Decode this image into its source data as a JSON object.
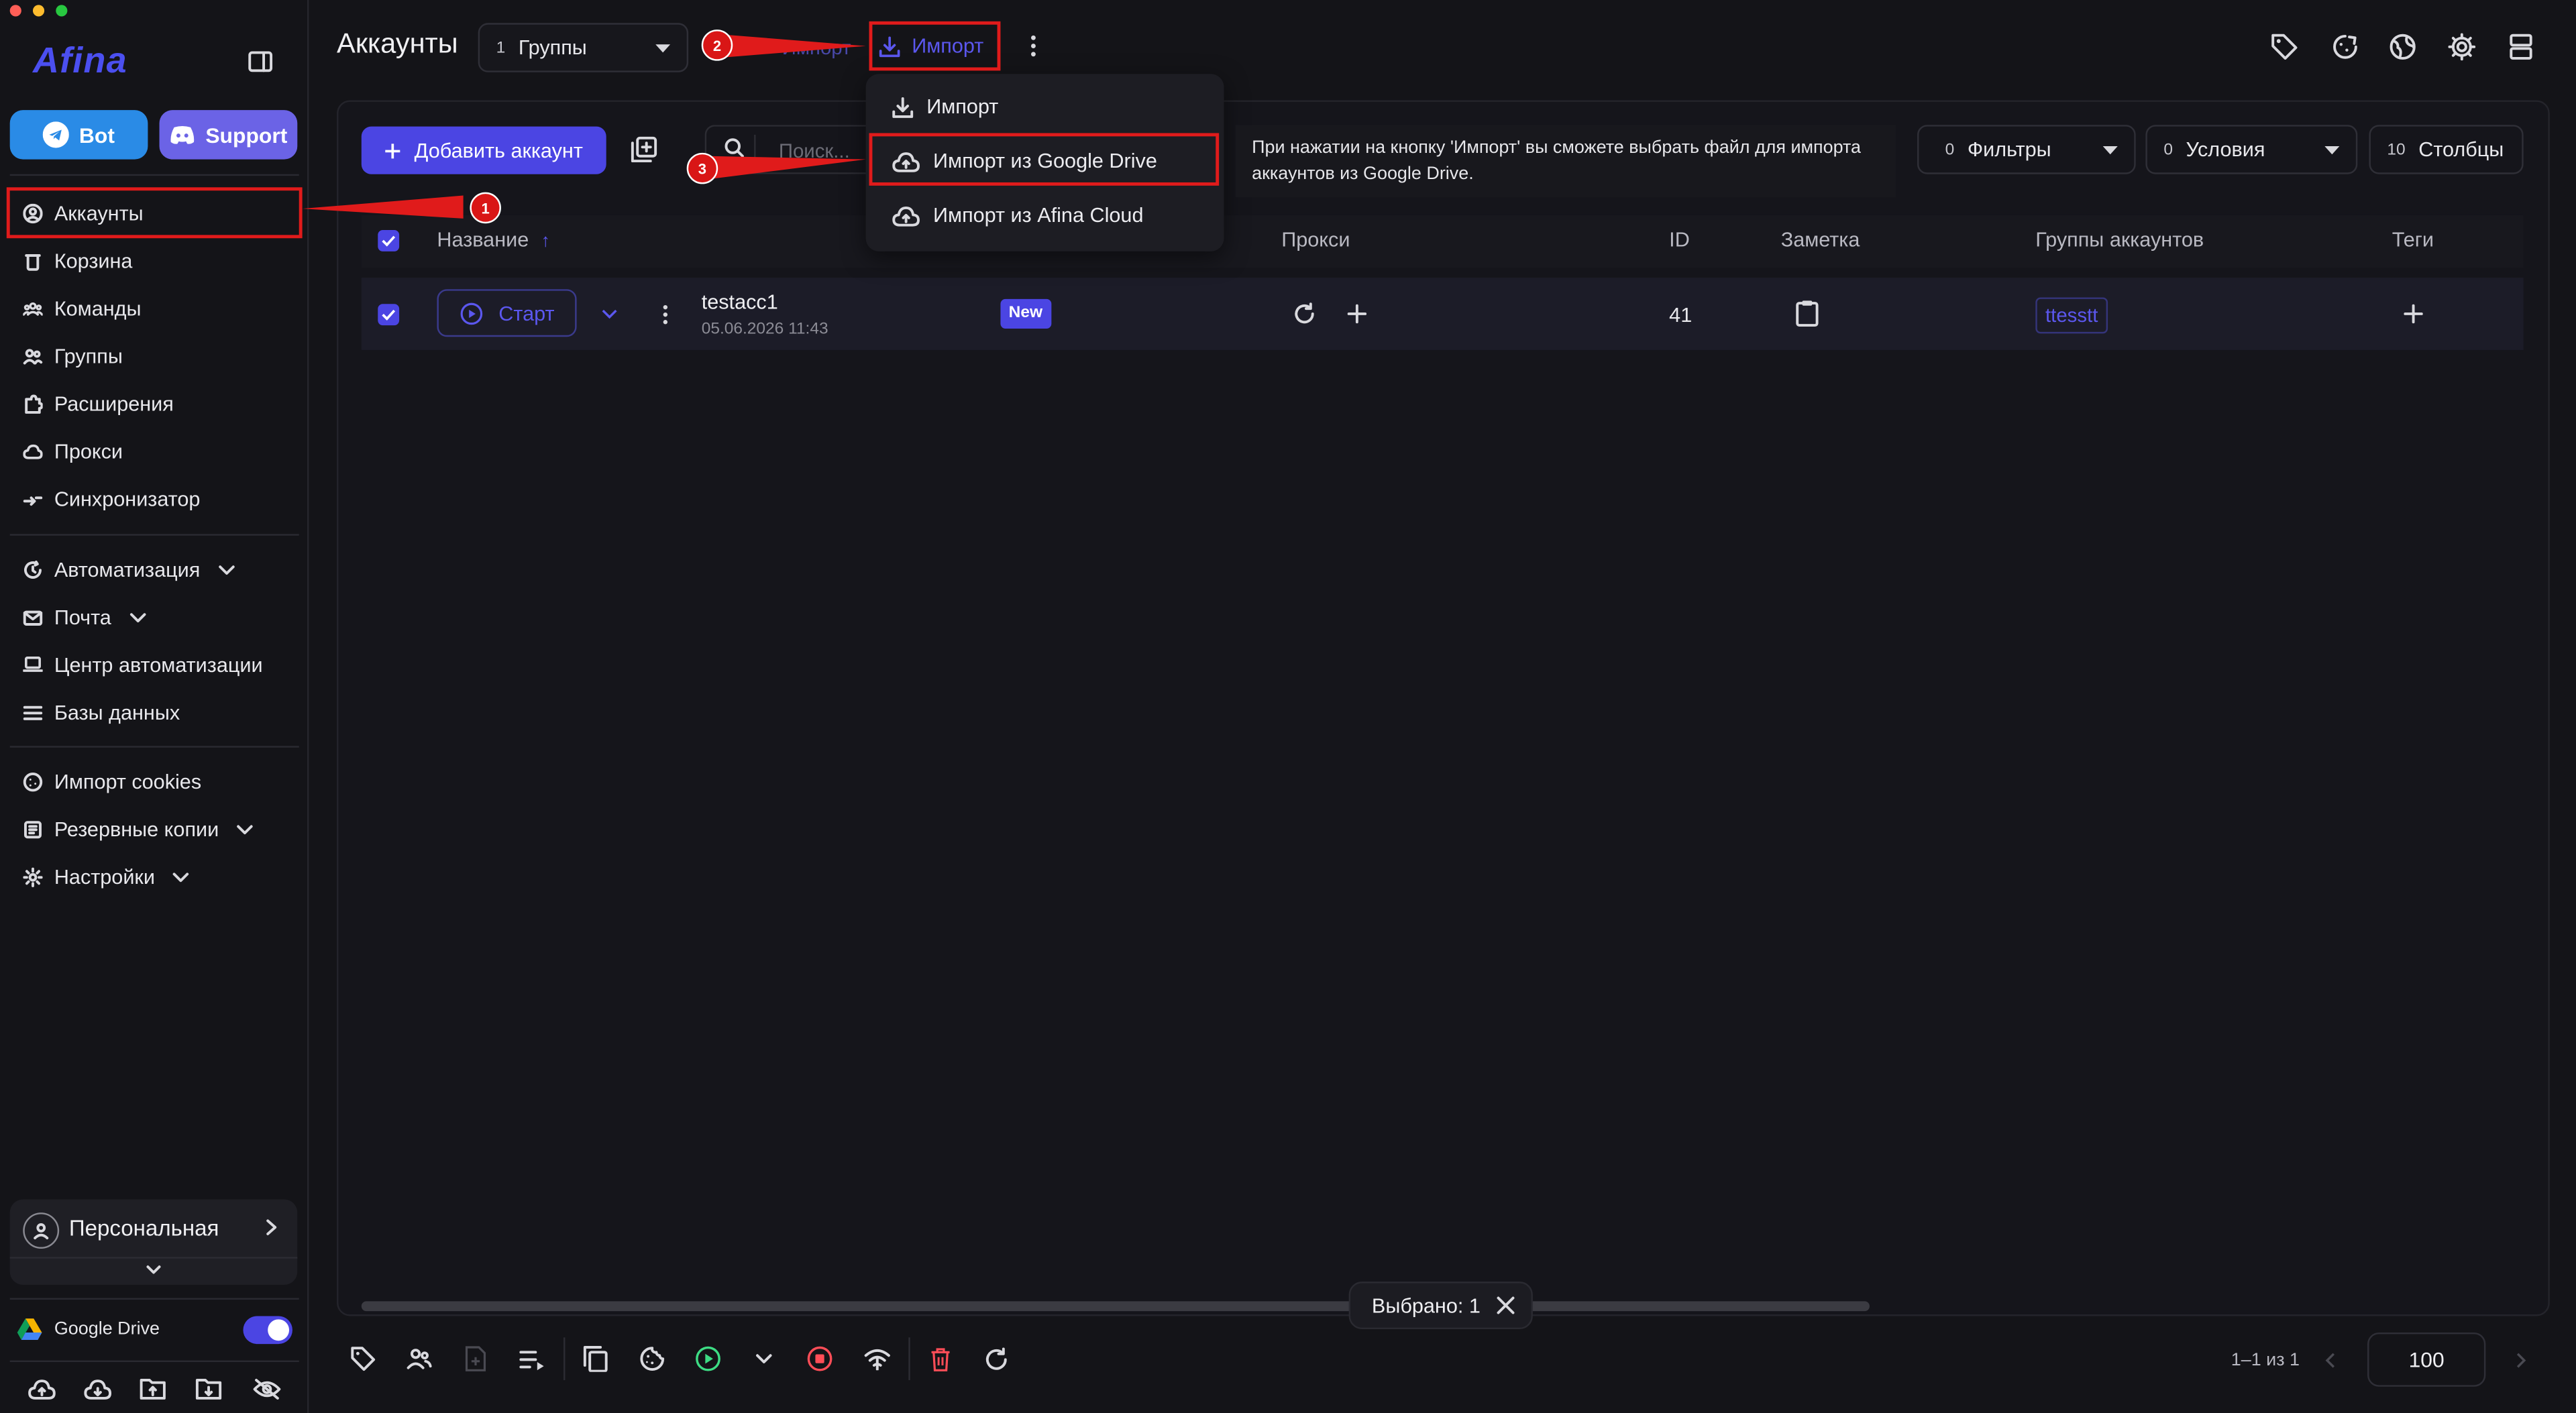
{
  "window": {
    "title": "Аккаунты"
  },
  "sidebar": {
    "logo": "Afina",
    "bot_label": "Bot",
    "support_label": "Support",
    "items_top": [
      {
        "label": "Аккаунты",
        "icon": "user-circle-icon"
      },
      {
        "label": "Корзина",
        "icon": "trash-icon"
      },
      {
        "label": "Команды",
        "icon": "team-icon"
      },
      {
        "label": "Группы",
        "icon": "group-icon"
      },
      {
        "label": "Расширения",
        "icon": "puzzle-icon"
      },
      {
        "label": "Прокси",
        "icon": "cloud-icon"
      },
      {
        "label": "Синхронизатор",
        "icon": "sync-icon"
      }
    ],
    "items_mid": [
      {
        "label": "Автоматизация",
        "icon": "automation-icon"
      },
      {
        "label": "Почта",
        "icon": "mail-icon"
      },
      {
        "label": "Центр автоматизации",
        "icon": "laptop-icon"
      },
      {
        "label": "Базы данных",
        "icon": "list-icon"
      }
    ],
    "items_low": [
      {
        "label": "Импорт cookies",
        "icon": "cookie-icon"
      },
      {
        "label": "Резервные копии",
        "icon": "backup-icon"
      },
      {
        "label": "Настройки",
        "icon": "gear-icon"
      }
    ],
    "workspace": "Персональная",
    "google_drive_label": "Google Drive",
    "google_drive_enabled": true
  },
  "header": {
    "title": "Аккаунты",
    "groups_count": "1",
    "groups_label": "Группы",
    "import_label": "Импорт",
    "hidden_label": "Импорт"
  },
  "toolbar": {
    "add_account": "Добавить аккаунт",
    "search_placeholder": "Поиск...",
    "filters_count": "0",
    "filters_label": "Фильтры",
    "conditions_count": "0",
    "conditions_label": "Условия",
    "columns_count": "10",
    "columns_label": "Столбцы"
  },
  "table": {
    "headers": {
      "name": "Название",
      "proxy": "Прокси",
      "id": "ID",
      "note": "Заметка",
      "groups": "Группы аккаунтов",
      "tags": "Теги"
    },
    "rows": [
      {
        "start_label": "Старт",
        "name": "testacc1",
        "date": "05.06.2026 11:43",
        "status": "New",
        "id": "41",
        "group": "ttesstt"
      }
    ]
  },
  "import_menu": {
    "items": [
      "Импорт",
      "Импорт из Google Drive",
      "Импорт из Afina Cloud"
    ],
    "tooltip": "При нажатии на кнопку 'Импорт' вы сможете выбрать файл для импорта аккаунтов из Google Drive."
  },
  "annotations": [
    "1",
    "2",
    "3"
  ],
  "footer": {
    "selected": "Выбрано: 1",
    "pagination": "1–1 из 1",
    "page_size": "100"
  },
  "colors": {
    "accent": "#4b45e3",
    "annotation": "#e01b1b",
    "status_new": "#4b45e3"
  }
}
